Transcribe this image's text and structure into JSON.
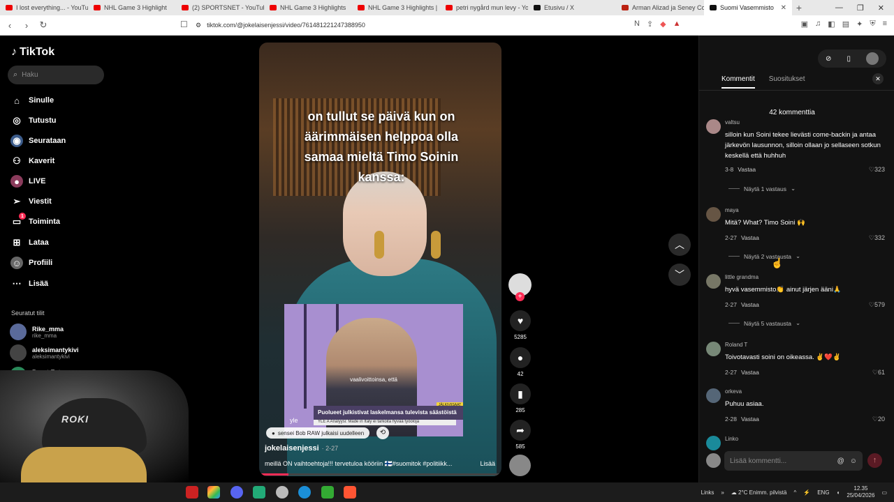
{
  "browser": {
    "tabs": [
      {
        "title": "I lost everything... - YouTu",
        "icon": "youtube-icon"
      },
      {
        "title": "NHL Game 3 Highlight",
        "icon": "youtube-icon"
      },
      {
        "title": "(2) SPORTSNET - YouTube",
        "icon": "youtube-icon"
      },
      {
        "title": "NHL Game 3 Highlights",
        "icon": "youtube-icon"
      },
      {
        "title": "NHL Game 3 Highlights | ",
        "icon": "youtube-icon"
      },
      {
        "title": "petri nygård mun levy - Yo",
        "icon": "youtube-icon"
      },
      {
        "title": "Etusivu / X",
        "icon": "x-icon"
      },
      {
        "title": "Arman Alizad ja Seney Co",
        "icon": "arman-icon"
      },
      {
        "title": "Suomi Vasemmisto",
        "icon": "tiktok-icon",
        "active": true
      }
    ],
    "new_tab": "+",
    "url": "tiktok.com/@jokelaisenjessi/video/761481221247388950"
  },
  "sidebar": {
    "logo": "TikTok",
    "search_placeholder": "Haku",
    "nav": [
      {
        "label": "Sinulle",
        "icon": "home-icon"
      },
      {
        "label": "Tutustu",
        "icon": "compass-icon"
      },
      {
        "label": "Seurataan",
        "icon": "following-icon"
      },
      {
        "label": "Kaverit",
        "icon": "friends-icon"
      },
      {
        "label": "LIVE",
        "icon": "live-icon"
      },
      {
        "label": "Viestit",
        "icon": "messages-icon"
      },
      {
        "label": "Toiminta",
        "icon": "activity-icon",
        "badge": "1"
      },
      {
        "label": "Lataa",
        "icon": "upload-icon"
      },
      {
        "label": "Profiili",
        "icon": "profile-icon"
      },
      {
        "label": "Lisää",
        "icon": "more-icon"
      }
    ],
    "followed_label": "Seuratut tilit",
    "followed": [
      {
        "name": "Rike_mma",
        "handle": "rike_mma"
      },
      {
        "name": "aleksimantykivi",
        "handle": "aleksimantykivi"
      },
      {
        "name": "Beazt Extra",
        "handle": "beazt"
      }
    ]
  },
  "webcam": {
    "helmet_text": "ROKI"
  },
  "video": {
    "caption_lines": [
      "on tullut se päivä kun on",
      "äärimmäisen helppoa olla",
      "samaa mieltä Timo Soinin",
      "kanssa:"
    ],
    "inset_subtitle": "vaalivoittoinsa, että",
    "inset_headline": "Puolueet julkistivat laskelmansa tulevista säästöistä",
    "inset_subline": "YLE A   Analyysi: Made in Italy ei tarkoita hyvää työoloja",
    "inset_tag": "JÄLKIVIISAAT",
    "inset_logo": "yle",
    "repost_text": "sensei Bob RAW julkaisi uudelleen",
    "author": "jokelaisenjessi",
    "date": "· 2-27",
    "description": "meillä ON vaihtoehtoja!!! tervetuloa kööriin 🇫🇮#suomitok #politiikk...",
    "more": "Lisää",
    "progress": 0.12
  },
  "actions": {
    "likes": "5285",
    "comments": "42",
    "saves": "285",
    "shares": "585"
  },
  "panel": {
    "tabs": [
      "Kommentit",
      "Suositukset"
    ],
    "count_label": "42 kommenttia",
    "comments": [
      {
        "user": "valtsu",
        "text": "silloin kun Soini tekee lievästi come-backin ja antaa järkevön lausunnon, silloin ollaan jo sellaseen sotkun keskellä että huhhuh",
        "date": "3-8",
        "likes": "323",
        "show_replies": "Näytä 1 vastaus"
      },
      {
        "user": "maya",
        "text": "Mitä? What? Timo Soini 🙌",
        "date": "2-27",
        "likes": "332",
        "show_replies": "Näytä 2 vastausta"
      },
      {
        "user": "little grandma",
        "text": "hyvä vasemmisto👏 ainut järjen ääni🙏",
        "date": "2-27",
        "likes": "579",
        "show_replies": "Näytä 5 vastausta"
      },
      {
        "user": "Roland T",
        "text": "Toivotavasti soini on oikeassa. ✌️❤️✌️",
        "date": "2-27",
        "likes": "61"
      },
      {
        "user": "orkeva",
        "text": "Puhuu asiaa.",
        "date": "2-28",
        "likes": "20"
      },
      {
        "user": "Linko",
        "text": "",
        "date": "",
        "likes": ""
      }
    ],
    "reply_label": "Vastaa",
    "input_placeholder": "Lisää kommentti..."
  },
  "taskbar": {
    "links": "Links",
    "weather": "2°C  Enimm. pilvistä",
    "lang": "ENG",
    "time": "12.35",
    "date": "25/04/2026"
  }
}
